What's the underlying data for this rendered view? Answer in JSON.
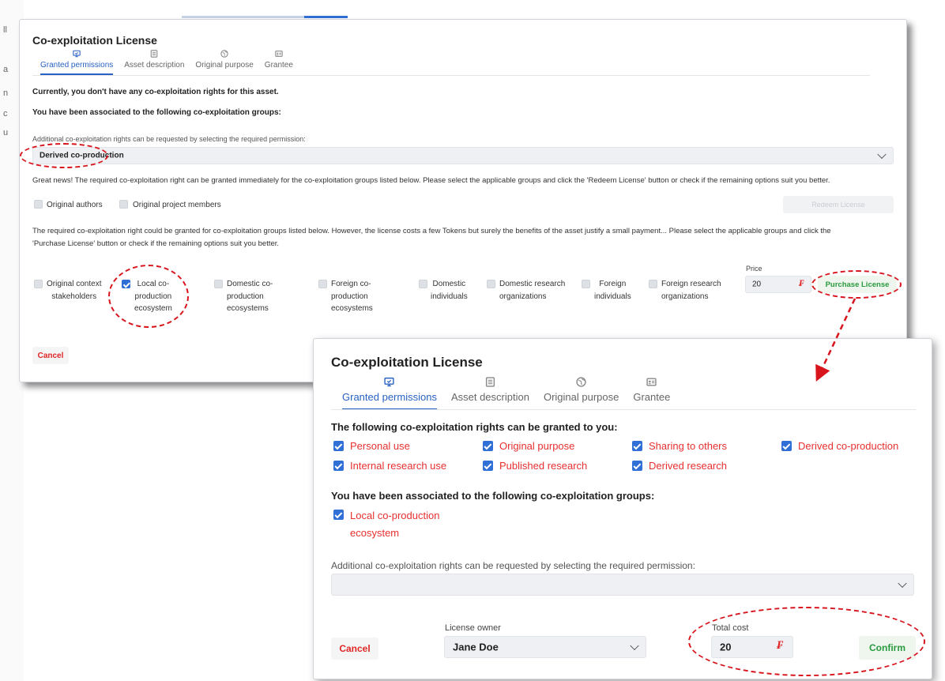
{
  "background": {
    "fragments": [
      "ll",
      "a",
      "n",
      "c",
      "u"
    ]
  },
  "dialog1": {
    "title": "Co-exploitation License",
    "tabs": [
      {
        "label": "Granted permissions",
        "icon": "permissions-icon"
      },
      {
        "label": "Asset description",
        "icon": "document-icon"
      },
      {
        "label": "Original purpose",
        "icon": "globe-icon"
      },
      {
        "label": "Grantee",
        "icon": "id-card-icon"
      }
    ],
    "no_rights_text": "Currently, you don't have any co-exploitation rights for this asset.",
    "groups_heading": "You have been associated to the following co-exploitation groups:",
    "additional_label": "Additional co-exploitation rights can be requested by selecting the required permission:",
    "selected_permission": "Derived co-production",
    "great_news_text": "Great news! The required co-exploitation right can be granted immediately for the co-exploitation groups listed below. Please select the applicable groups and click the 'Redeem License' button or check if the remaining options suit you better.",
    "free_groups": [
      {
        "label": "Original authors",
        "checked": false
      },
      {
        "label": "Original project members",
        "checked": false
      }
    ],
    "redeem_label": "Redeem License",
    "paid_text_line1": "The required co-exploitation right could be granted for co-exploitation groups listed below. However, the license costs a few Tokens but surely the benefits of the asset justify a small payment... Please select the applicable groups and click the",
    "paid_text_line2": "'Purchase License' button or check if the remaining options suit you better.",
    "paid_groups": [
      {
        "lines": [
          "Original context",
          "stakeholders"
        ],
        "checked": false
      },
      {
        "lines": [
          "Local co-",
          "production",
          "ecosystem"
        ],
        "checked": true
      },
      {
        "lines": [
          "Domestic co-",
          "production",
          "ecosystems"
        ],
        "checked": false
      },
      {
        "lines": [
          "Foreign co-",
          "production",
          "ecosystems"
        ],
        "checked": false
      },
      {
        "lines": [
          "Domestic",
          "individuals"
        ],
        "checked": false
      },
      {
        "lines": [
          "Domestic research",
          "organizations"
        ],
        "checked": false
      },
      {
        "lines": [
          "Foreign",
          "individuals"
        ],
        "checked": false
      },
      {
        "lines": [
          "Foreign research",
          "organizations"
        ],
        "checked": false
      }
    ],
    "price_label": "Price",
    "price_value": "20",
    "token_symbol": "₣",
    "purchase_label": "Purchase License",
    "cancel_label": "Cancel"
  },
  "dialog2": {
    "title": "Co-exploitation License",
    "tabs": [
      {
        "label": "Granted permissions",
        "icon": "permissions-icon"
      },
      {
        "label": "Asset description",
        "icon": "document-icon"
      },
      {
        "label": "Original purpose",
        "icon": "globe-icon"
      },
      {
        "label": "Grantee",
        "icon": "id-card-icon"
      }
    ],
    "granted_heading": "The following co-exploitation rights can be granted to you:",
    "rights": [
      [
        "Personal use",
        "Original purpose",
        "Sharing to others",
        "Derived co-production"
      ],
      [
        "Internal research use",
        "Published research",
        "Derived research"
      ]
    ],
    "groups_heading": "You have been associated to the following co-exploitation groups:",
    "group_lines": [
      "Local co-production",
      "ecosystem"
    ],
    "additional_label": "Additional co-exploitation rights can be requested by selecting the required permission:",
    "cancel_label": "Cancel",
    "owner_label": "License owner",
    "owner_value": "Jane Doe",
    "total_label": "Total cost",
    "total_value": "20",
    "token_symbol": "₣",
    "confirm_label": "Confirm"
  },
  "colors": {
    "accent": "#2962c4",
    "annotation": "#d8151d",
    "rights_text": "#e83030",
    "confirm": "#2a9a3f"
  }
}
